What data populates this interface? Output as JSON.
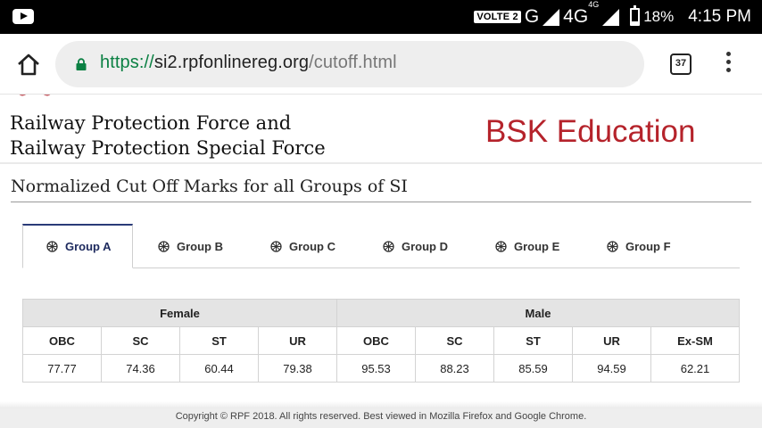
{
  "status_bar": {
    "volte": "VOLTE 2",
    "network_g": "G",
    "network_4g": "4G",
    "network_4g_sup": "4G",
    "battery_pct": "18%",
    "time": "4:15 PM",
    "icons": [
      "youtube-icon",
      "signal-icon",
      "battery-icon"
    ]
  },
  "browser": {
    "url_scheme": "https://",
    "url_host": "si2.rpfonlinereg.org",
    "url_path": "/cutoff.html",
    "tab_count": "37",
    "icons": [
      "home-icon",
      "lock-icon",
      "tabs-icon",
      "menu-icon"
    ],
    "secure_color": "#0b8043"
  },
  "page": {
    "org_line1": "Railway Protection Force and",
    "org_line2": "Railway Protection Special Force",
    "brand": "BSK Education",
    "brand_color": "#b5232b",
    "section_title": "Normalized Cut Off Marks for all Groups of SI",
    "tabs": [
      {
        "label": "Group A",
        "active": true
      },
      {
        "label": "Group B",
        "active": false
      },
      {
        "label": "Group C",
        "active": false
      },
      {
        "label": "Group D",
        "active": false
      },
      {
        "label": "Group E",
        "active": false
      },
      {
        "label": "Group F",
        "active": false
      }
    ],
    "table": {
      "groups": [
        "Female",
        "Male"
      ],
      "columns": [
        "OBC",
        "SC",
        "ST",
        "UR",
        "OBC",
        "SC",
        "ST",
        "UR",
        "Ex-SM"
      ],
      "values": [
        "77.77",
        "74.36",
        "60.44",
        "79.38",
        "95.53",
        "88.23",
        "85.59",
        "94.59",
        "62.21"
      ]
    },
    "footer": "Copyright © RPF 2018. All rights reserved. Best viewed in Mozilla Firefox and Google Chrome."
  }
}
